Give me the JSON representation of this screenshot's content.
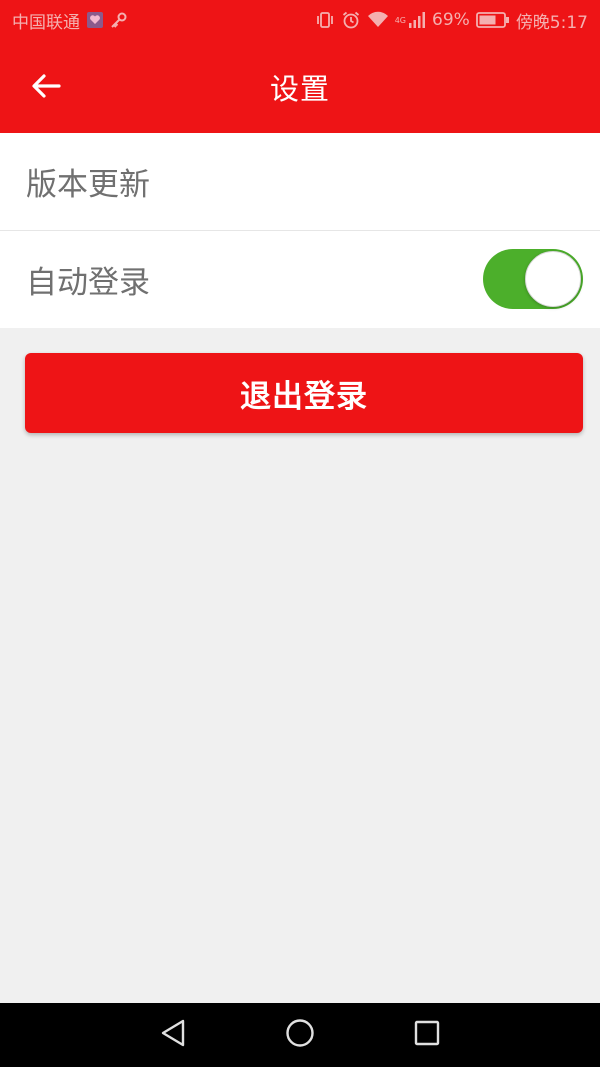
{
  "status_bar": {
    "carrier": "中国联通",
    "network_type": "4G",
    "battery_percent": "69%",
    "time": "傍晚5:17",
    "icons": [
      "app-notification-icon",
      "key-icon",
      "vibrate-icon",
      "alarm-icon",
      "wifi-icon",
      "signal-icon",
      "battery-icon"
    ]
  },
  "app_bar": {
    "title": "设置",
    "back_icon": "arrow-left-icon"
  },
  "settings": {
    "version_update_label": "版本更新",
    "auto_login_label": "自动登录",
    "auto_login_enabled": true
  },
  "logout_button": {
    "label": "退出登录"
  },
  "colors": {
    "primary_red": "#ee1416",
    "toggle_on": "#4caf2b",
    "background": "#f0f0f0"
  },
  "nav_bar": {
    "icons": [
      "back-triangle-icon",
      "home-circle-icon",
      "recents-square-icon"
    ]
  }
}
